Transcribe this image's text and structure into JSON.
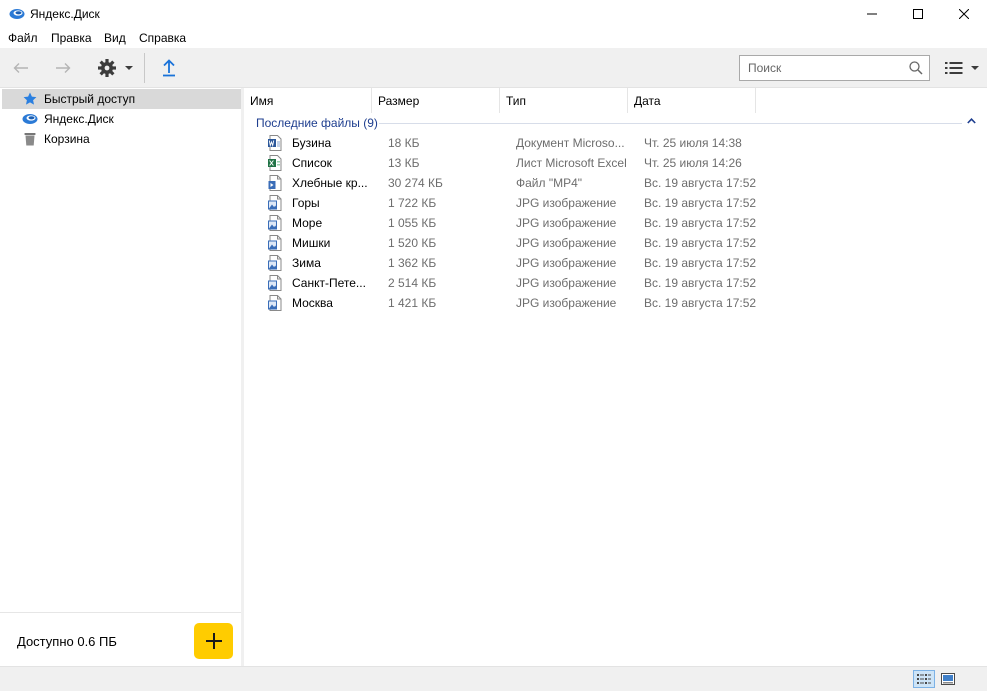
{
  "window": {
    "title": "Яндекс.Диск"
  },
  "menu": [
    "Файл",
    "Правка",
    "Вид",
    "Справка"
  ],
  "search": {
    "placeholder": "Поиск"
  },
  "sidebar": {
    "items": [
      {
        "label": "Быстрый доступ",
        "icon": "star-icon",
        "active": true
      },
      {
        "label": "Яндекс.Диск",
        "icon": "yandex-disk-icon",
        "active": false
      },
      {
        "label": "Корзина",
        "icon": "trash-icon",
        "active": false
      }
    ],
    "available": "Доступно 0.6 ПБ"
  },
  "columns": [
    "Имя",
    "Размер",
    "Тип",
    "Дата"
  ],
  "group": {
    "title": "Последние файлы (9)"
  },
  "files": [
    {
      "name": "Бузина",
      "size": "18 КБ",
      "type": "Документ Microso...",
      "date": "Чт. 25 июля 14:38",
      "icon": "word-file-icon"
    },
    {
      "name": "Список",
      "size": "13 КБ",
      "type": "Лист Microsoft Excel",
      "date": "Чт. 25 июля 14:26",
      "icon": "excel-file-icon"
    },
    {
      "name": "Хлебные кр...",
      "size": "30 274 КБ",
      "type": "Файл \"MP4\"",
      "date": "Вс. 19 августа 17:52",
      "icon": "video-file-icon"
    },
    {
      "name": "Горы",
      "size": "1 722 КБ",
      "type": "JPG изображение",
      "date": "Вс. 19 августа 17:52",
      "icon": "image-file-icon"
    },
    {
      "name": "Море",
      "size": "1 055 КБ",
      "type": "JPG изображение",
      "date": "Вс. 19 августа 17:52",
      "icon": "image-file-icon"
    },
    {
      "name": "Мишки",
      "size": "1 520 КБ",
      "type": "JPG изображение",
      "date": "Вс. 19 августа 17:52",
      "icon": "image-file-icon"
    },
    {
      "name": "Зима",
      "size": "1 362 КБ",
      "type": "JPG изображение",
      "date": "Вс. 19 августа 17:52",
      "icon": "image-file-icon"
    },
    {
      "name": "Санкт-Пете...",
      "size": "2 514 КБ",
      "type": "JPG изображение",
      "date": "Вс. 19 августа 17:52",
      "icon": "image-file-icon"
    },
    {
      "name": "Москва",
      "size": "1 421 КБ",
      "type": "JPG изображение",
      "date": "Вс. 19 августа 17:52",
      "icon": "image-file-icon"
    }
  ],
  "colors": {
    "accent": "#ffcc00",
    "group_header": "#1e3e8f",
    "upload_blue": "#1a73d9",
    "selected_row": "#d9d9d9"
  }
}
